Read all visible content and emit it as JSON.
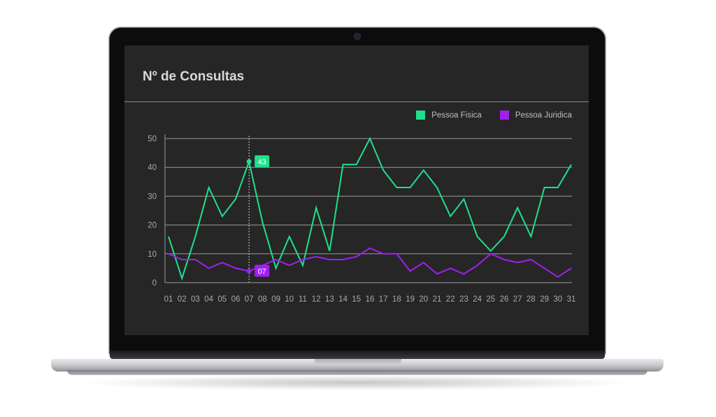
{
  "chart_data": {
    "type": "line",
    "title": "Nº de Consultas",
    "categories": [
      "01",
      "02",
      "03",
      "04",
      "05",
      "06",
      "07",
      "08",
      "09",
      "10",
      "11",
      "12",
      "13",
      "14",
      "15",
      "16",
      "17",
      "18",
      "19",
      "20",
      "21",
      "22",
      "23",
      "24",
      "25",
      "26",
      "27",
      "28",
      "29",
      "30",
      "31"
    ],
    "ylim": [
      0,
      50
    ],
    "yticks": [
      "0",
      "10",
      "20",
      "30",
      "40",
      "50"
    ],
    "grid": true,
    "legend_position": "top-right",
    "series": [
      {
        "name": "Pessoa Fisica",
        "color": "#1fe08a",
        "values": [
          16,
          1.5,
          16,
          33,
          23,
          29,
          42,
          21,
          5,
          16,
          6,
          26,
          11,
          41,
          41,
          50,
          39,
          33,
          33,
          39,
          33,
          23,
          29,
          16,
          11,
          16,
          26,
          16,
          33,
          33,
          41
        ]
      },
      {
        "name": "Pessoa Juridica",
        "color": "#a11ff0",
        "values": [
          10,
          8,
          8,
          5,
          7,
          5,
          4,
          6,
          8,
          6,
          8,
          9,
          8,
          8,
          9,
          12,
          10,
          10,
          4,
          7,
          3,
          5,
          3,
          6,
          10,
          8,
          7,
          8,
          5,
          2,
          5
        ]
      }
    ],
    "annotations": [
      {
        "category": "07",
        "series": "Pessoa Fisica",
        "label": "43"
      },
      {
        "category": "07",
        "series": "Pessoa Juridica",
        "label": "07"
      }
    ]
  }
}
